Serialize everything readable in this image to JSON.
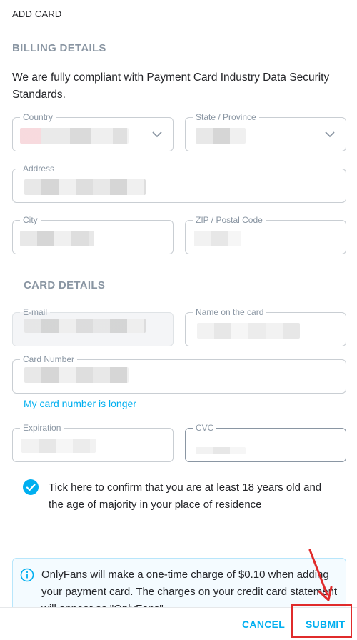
{
  "header": {
    "title": "ADD CARD"
  },
  "billing": {
    "title": "BILLING DETAILS",
    "intro": "We are fully compliant with Payment Card Industry Data Security Standards.",
    "country_label": "Country",
    "state_label": "State / Province",
    "address_label": "Address",
    "city_label": "City",
    "zip_label": "ZIP / Postal Code"
  },
  "card": {
    "title": "CARD DETAILS",
    "email_label": "E-mail",
    "name_label": "Name on the card",
    "number_label": "Card Number",
    "longer_link": "My card number is longer",
    "expiration_label": "Expiration",
    "cvc_label": "CVC"
  },
  "age_confirm": {
    "checked": true,
    "text": "Tick here to confirm that you are at least 18 years old and the age of majority in your place of residence"
  },
  "info": {
    "text": "OnlyFans will make a one-time charge of $0.10 when adding your payment card. The charges on your credit card statement will appear as \"OnlyFans\"."
  },
  "footer": {
    "cancel_label": "CANCEL",
    "submit_label": "SUBMIT"
  },
  "colors": {
    "accent": "#00aff0",
    "muted": "#8a96a3",
    "annotation": "#e02b2b"
  },
  "icons": [
    "chevron-down-icon",
    "checkmark-icon",
    "info-icon",
    "annotation-arrow-icon"
  ]
}
